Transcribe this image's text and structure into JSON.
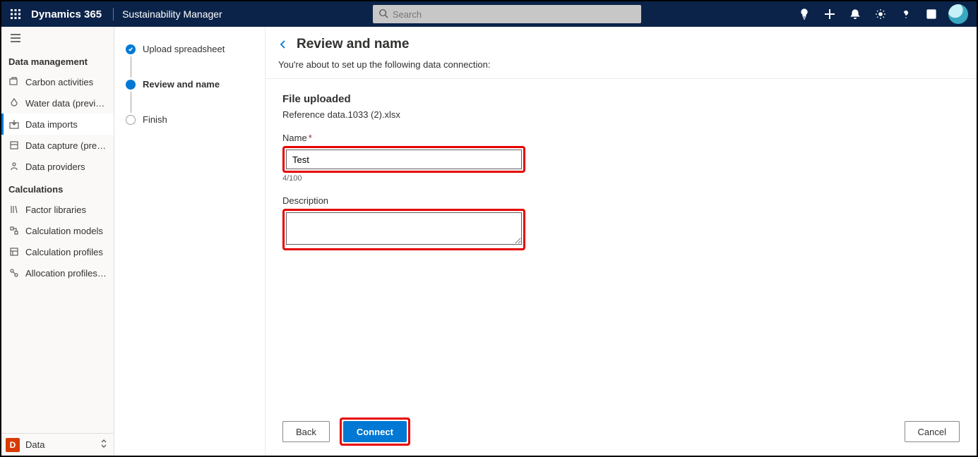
{
  "header": {
    "brand": "Dynamics 365",
    "app_name": "Sustainability Manager",
    "search_placeholder": "Search"
  },
  "leftnav": {
    "section_data_management": "Data management",
    "items_data": [
      "Carbon activities",
      "Water data (preview)",
      "Data imports",
      "Data capture (preview)",
      "Data providers"
    ],
    "section_calculations": "Calculations",
    "items_calc": [
      "Factor libraries",
      "Calculation models",
      "Calculation profiles",
      "Allocation profiles (p..."
    ],
    "footer_badge": "D",
    "footer_label": "Data"
  },
  "stepper": {
    "step1": "Upload spreadsheet",
    "step2": "Review and name",
    "step3": "Finish"
  },
  "main": {
    "title": "Review and name",
    "subtitle": "You're about to set up the following data connection:",
    "file_uploaded_heading": "File uploaded",
    "file_name": "Reference data.1033 (2).xlsx",
    "name_label": "Name",
    "name_value": "Test",
    "name_counter": "4/100",
    "description_label": "Description",
    "description_value": "",
    "back_btn": "Back",
    "connect_btn": "Connect",
    "cancel_btn": "Cancel"
  }
}
